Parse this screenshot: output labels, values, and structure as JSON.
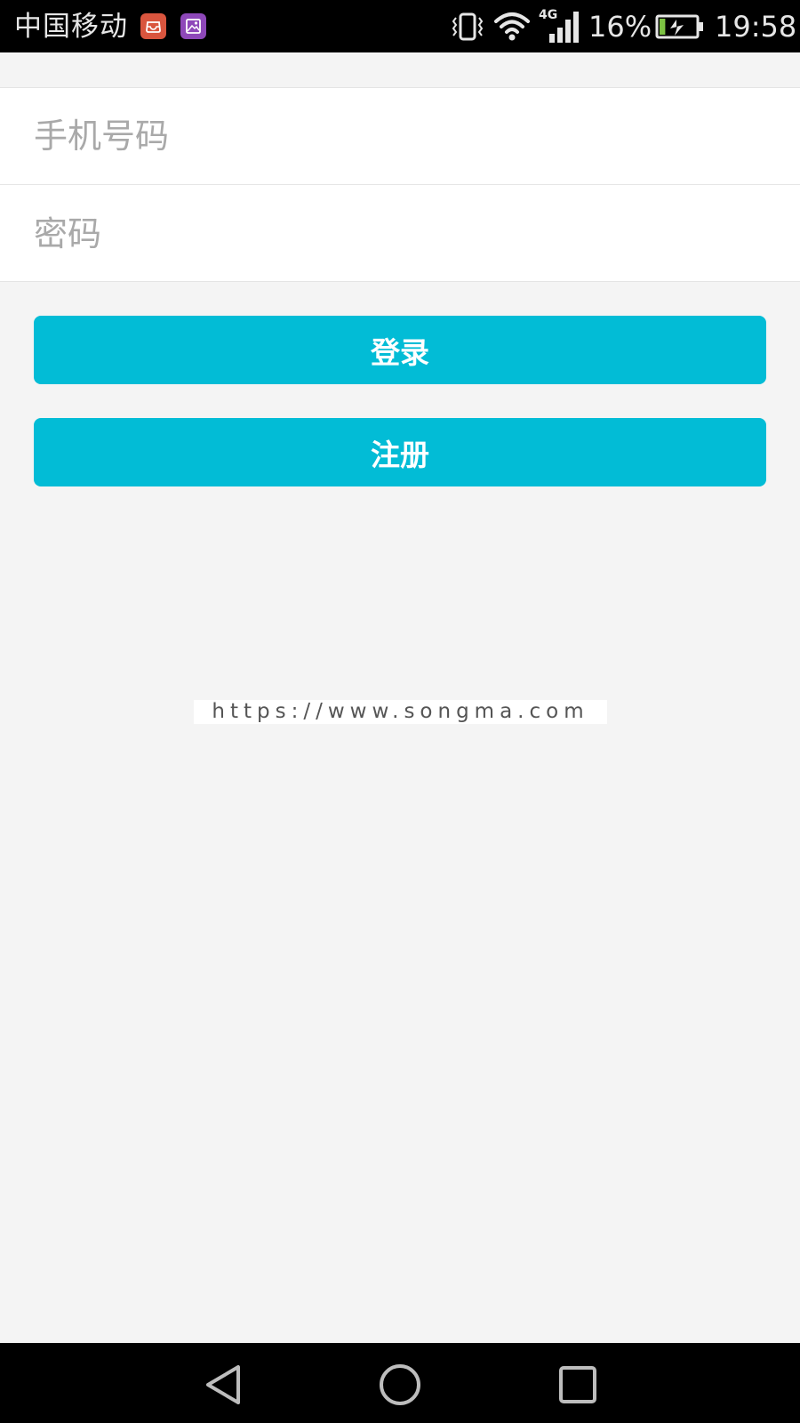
{
  "status_bar": {
    "carrier": "中国移动",
    "notification_icons": [
      "mail-icon",
      "gallery-icon"
    ],
    "vibrate_icon": "vibrate-icon",
    "wifi_icon": "wifi-icon",
    "network_type": "4G",
    "battery_percent": "16%",
    "battery_level": 0.16,
    "charging": true,
    "time": "19:58"
  },
  "form": {
    "phone": {
      "placeholder": "手机号码",
      "value": ""
    },
    "password": {
      "placeholder": "密码",
      "value": ""
    }
  },
  "buttons": {
    "login_label": "登录",
    "register_label": "注册"
  },
  "watermark": {
    "text": "https://www.songma.com"
  },
  "nav_bar": {
    "back_icon": "back-icon",
    "home_icon": "home-icon",
    "recents_icon": "recents-icon"
  },
  "colors": {
    "accent": "#02bcd6",
    "background": "#f4f4f4",
    "status_bar": "#000000",
    "placeholder": "#a9a9a9"
  }
}
